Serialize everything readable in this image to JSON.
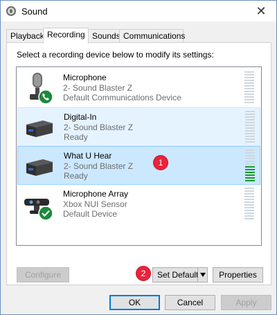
{
  "window": {
    "title": "Sound",
    "close_glyph": "✕"
  },
  "tabs": [
    {
      "label": "Playback",
      "active": false
    },
    {
      "label": "Recording",
      "active": true
    },
    {
      "label": "Sounds",
      "active": false
    },
    {
      "label": "Communications",
      "active": false
    }
  ],
  "instructions": "Select a recording device below to modify its settings:",
  "devices": [
    {
      "name": "Microphone",
      "line1": "2- Sound Blaster Z",
      "line2": "Default Communications Device",
      "icon": "microphone-icon",
      "status_badge": "phone-default-comm-badge",
      "level_fraction": 0.0,
      "state": "normal"
    },
    {
      "name": "Digital-In",
      "line1": "2- Sound Blaster Z",
      "line2": "Ready",
      "icon": "digital-device-icon",
      "status_badge": "",
      "level_fraction": 0.0,
      "state": "hover"
    },
    {
      "name": "What U Hear",
      "line1": "2- Sound Blaster Z",
      "line2": "Ready",
      "icon": "digital-device-icon",
      "status_badge": "",
      "level_fraction": 0.5,
      "state": "selected"
    },
    {
      "name": "Microphone Array",
      "line1": "Xbox NUI Sensor",
      "line2": "Default Device",
      "icon": "kinect-sensor-icon",
      "status_badge": "checkmark-default-badge",
      "level_fraction": 0.0,
      "state": "normal"
    }
  ],
  "callouts": {
    "one": "1",
    "two": "2"
  },
  "buttons": {
    "configure": "Configure",
    "set_default": "Set Default",
    "properties": "Properties",
    "ok": "OK",
    "cancel": "Cancel",
    "apply": "Apply"
  },
  "colors": {
    "selected_row": "#cce8ff",
    "hover_row": "#e5f3ff",
    "meter_active": "#1a9a2c",
    "meter_idle": "#cfd7de",
    "callout_badge": "#e8243b",
    "default_button_border": "#0078d7"
  }
}
